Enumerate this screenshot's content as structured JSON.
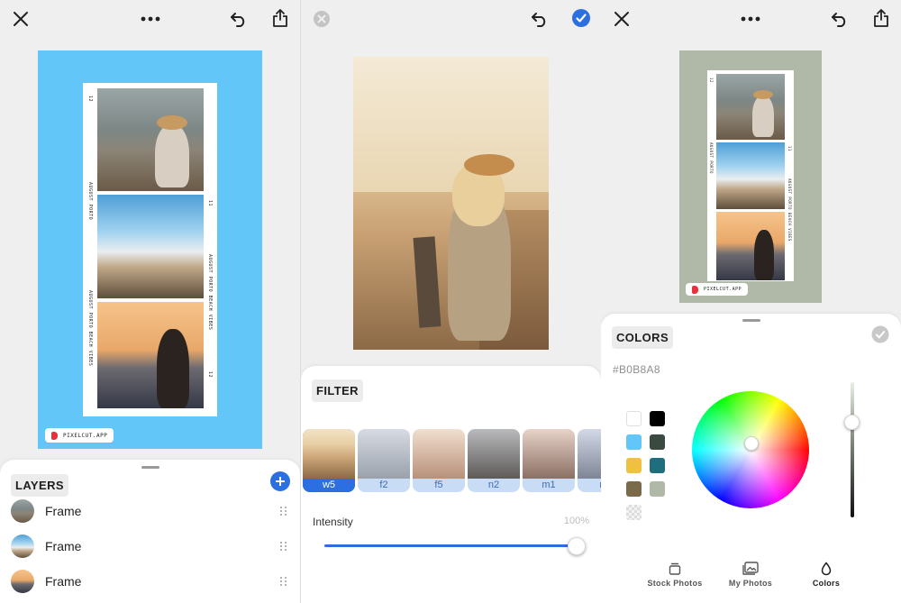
{
  "layers_panel": {
    "strip_label_top": "AUGUST PORTO",
    "strip_label_mid": "AUGUST PORTO BEACH VIBES",
    "strip_label_bottom": "AUGUST PORTO BEACH VIBES",
    "strip_numbers": [
      "12",
      "11",
      "12"
    ],
    "watermark": "PIXELCUT.APP",
    "canvas_color": "#63C6F9",
    "title": "LAYERS",
    "layers": [
      {
        "name": "Frame"
      },
      {
        "name": "Frame"
      },
      {
        "name": "Frame"
      }
    ]
  },
  "filter_panel": {
    "title": "FILTER",
    "filters": [
      {
        "label": "w5",
        "selected": true
      },
      {
        "label": "f2",
        "selected": false
      },
      {
        "label": "f5",
        "selected": false
      },
      {
        "label": "n2",
        "selected": false
      },
      {
        "label": "m1",
        "selected": false
      },
      {
        "label": "m",
        "selected": false
      }
    ],
    "intensity_label": "Intensity",
    "intensity_value": "100%",
    "intensity_fraction": 1.0,
    "accent": "#2C6FE0"
  },
  "colors_panel": {
    "strip_label_top": "AUGUST PORTO",
    "strip_label_mid": "AUGUST PORTO BEACH VIBES",
    "strip_numbers": [
      "12",
      "11"
    ],
    "watermark": "PIXELCUT.APP",
    "canvas_color": "#B0B8A8",
    "title": "COLORS",
    "hex_value": "#B0B8A8",
    "swatches": [
      "#FFFFFF",
      "#000000",
      "#63C6F9",
      "#3A4A40",
      "#F0C040",
      "#1E6E7E",
      "#7A6A4A",
      "#B0B8A8",
      "transparent"
    ],
    "tabs": [
      {
        "label": "Stock Photos",
        "icon": "stock-photos-icon"
      },
      {
        "label": "My Photos",
        "icon": "my-photos-icon"
      },
      {
        "label": "Colors",
        "icon": "drop-icon",
        "active": true
      }
    ]
  }
}
